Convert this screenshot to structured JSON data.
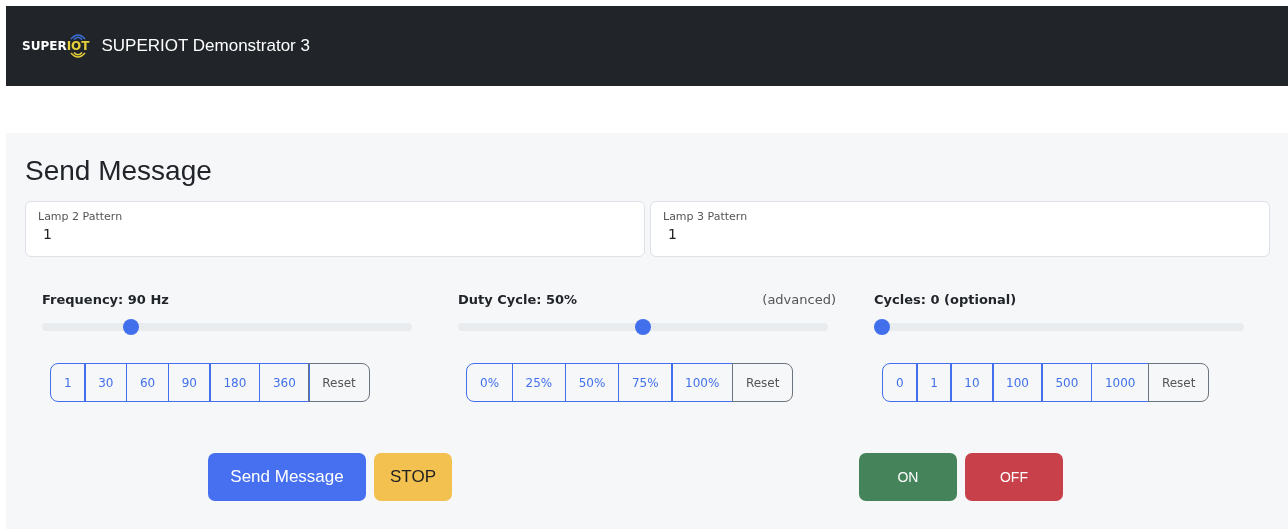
{
  "navbar": {
    "logo": {
      "part_1": "SUPER",
      "part_2": "IOT"
    },
    "title": "SUPERIOT Demonstrator 3"
  },
  "panel": {
    "heading": "Send Message",
    "fields": [
      {
        "label": "Lamp 2 Pattern",
        "value": "1"
      },
      {
        "label": "Lamp 3 Pattern",
        "value": "1"
      }
    ],
    "controls": [
      {
        "label": "Frequency: 90 Hz",
        "level": 0.23,
        "options": [
          {
            "label": "1",
            "kind": "option"
          },
          {
            "label": "30",
            "kind": "option"
          },
          {
            "label": "60",
            "kind": "option"
          },
          {
            "label": "90",
            "kind": "option"
          },
          {
            "label": "180",
            "kind": "option"
          },
          {
            "label": "360",
            "kind": "option"
          },
          {
            "label": "Reset",
            "kind": "reset"
          }
        ]
      },
      {
        "label": "Duty Cycle: 50%",
        "note": "(advanced)",
        "level": 0.5,
        "options": [
          {
            "label": "0%",
            "kind": "option"
          },
          {
            "label": "25%",
            "kind": "option"
          },
          {
            "label": "50%",
            "kind": "option"
          },
          {
            "label": "75%",
            "kind": "option"
          },
          {
            "label": "100%",
            "kind": "option"
          },
          {
            "label": "Reset",
            "kind": "reset"
          }
        ]
      },
      {
        "label": "Cycles: 0 (optional)",
        "level": 0,
        "options": [
          {
            "label": "0",
            "kind": "option"
          },
          {
            "label": "1",
            "kind": "option"
          },
          {
            "label": "10",
            "kind": "option"
          },
          {
            "label": "100",
            "kind": "option"
          },
          {
            "label": "500",
            "kind": "option"
          },
          {
            "label": "1000",
            "kind": "option"
          },
          {
            "label": "Reset",
            "kind": "reset"
          }
        ]
      }
    ],
    "actions_left": [
      {
        "label": "Send Message",
        "kind": "primary"
      },
      {
        "label": "STOP",
        "kind": "warning"
      }
    ],
    "actions_right": [
      {
        "label": "ON",
        "kind": "success"
      },
      {
        "label": "OFF",
        "kind": "danger"
      }
    ]
  }
}
